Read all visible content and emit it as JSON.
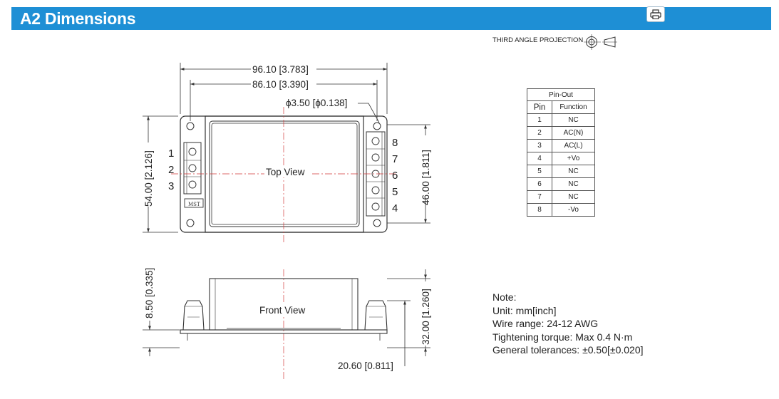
{
  "header": {
    "title": "A2 Dimensions",
    "print_icon": "printer-icon",
    "color": "#1e8fd5"
  },
  "projection": {
    "label": "THIRD ANGLE PROJECTION",
    "icon": "third-angle-projection-icon"
  },
  "drawing": {
    "dim_overall_width": "96.10 [3.783]",
    "dim_hole_spacing": "86.10 [3.390]",
    "dim_hole_diameter": "ϕ3.50 [ϕ0.138]",
    "dim_overall_height": "54.00 [2.126]",
    "dim_terminal_height": "46.00 [1.811]",
    "dim_flange_height": "8.50 [0.335]",
    "dim_total_depth": "32.00 [1.260]",
    "dim_terminal_offset": "20.60 [0.811]",
    "top_view_label": "Top View",
    "front_view_label": "Front View",
    "left_terminal_numbers": [
      "1",
      "2",
      "3"
    ],
    "right_terminal_numbers": [
      "8",
      "7",
      "6",
      "5",
      "4"
    ],
    "logo_text": "MST"
  },
  "pinout": {
    "caption": "Pin-Out",
    "headers": {
      "pin": "Pin",
      "function": "Function"
    },
    "rows": [
      {
        "pin": "1",
        "function": "NC"
      },
      {
        "pin": "2",
        "function": "AC(N)"
      },
      {
        "pin": "3",
        "function": "AC(L)"
      },
      {
        "pin": "4",
        "function": "+Vo"
      },
      {
        "pin": "5",
        "function": "NC"
      },
      {
        "pin": "6",
        "function": "NC"
      },
      {
        "pin": "7",
        "function": "NC"
      },
      {
        "pin": "8",
        "function": "-Vo"
      }
    ]
  },
  "notes": {
    "title": "Note:",
    "unit": "Unit: mm[inch]",
    "wire": "Wire range: 24-12 AWG",
    "torque": "Tightening torque: Max 0.4 N·m",
    "tolerance": "General tolerances: ±0.50[±0.020]"
  }
}
